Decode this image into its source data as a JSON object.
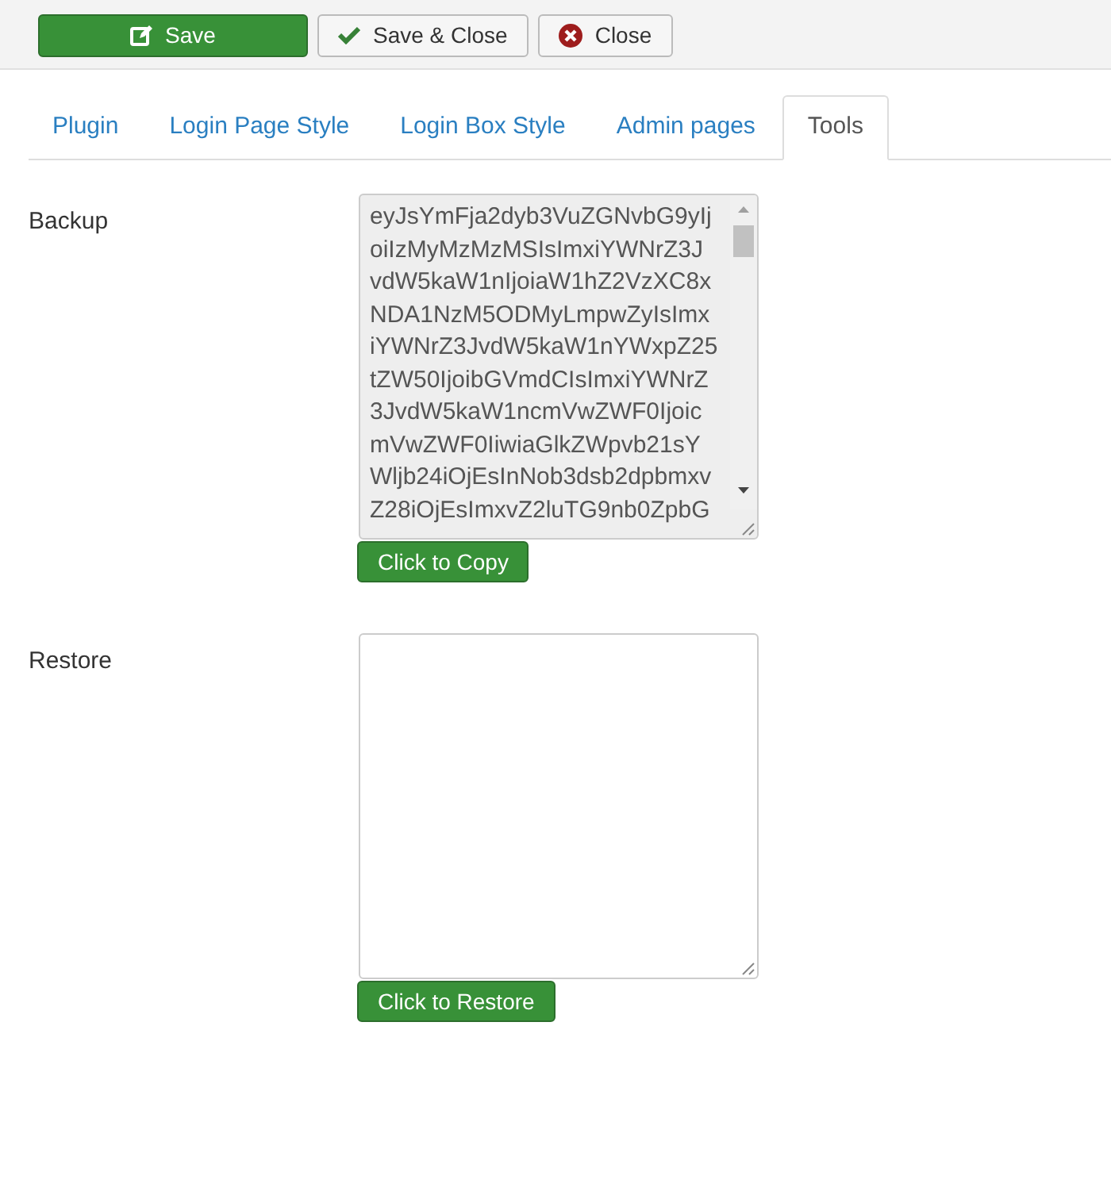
{
  "toolbar": [
    {
      "label": "Save",
      "kind": "save"
    },
    {
      "label": "Save & Close",
      "kind": "save_close"
    },
    {
      "label": "Close",
      "kind": "close"
    }
  ],
  "tabs": [
    {
      "label": "Plugin",
      "selected": false
    },
    {
      "label": "Login Page Style",
      "selected": false
    },
    {
      "label": "Login Box Style",
      "selected": false
    },
    {
      "label": "Admin pages",
      "selected": false
    },
    {
      "label": "Tools",
      "selected": true
    }
  ],
  "fields": [
    {
      "label": "Backup",
      "readonly": true,
      "lines": [
        "eyJsYmFja2dyb3VuZGNvbG9yIj",
        "oiIzMyMzMzMSIsImxiYWNrZ3J",
        "vdW5kaW1nIjoiaW1hZ2VzXC8x",
        "NDA1NzM5ODMyLmpwZyIsImx",
        "iYWNrZ3JvdW5kaW1nYWxpZ25",
        "tZW50IjoibGVmdCIsImxiYWNrZ",
        "3JvdW5kaW1ncmVwZWF0Ijoic",
        "mVwZWF0IiwiaGlkZWpvb21sY",
        "Wljb24iOjEsInNob3dsb2dpbmxv",
        "Z28iOjEsImxvZ2luTG9nb0ZpbG"
      ],
      "button": "Click to Copy"
    },
    {
      "label": "Restore",
      "readonly": false,
      "button": "Click to Restore"
    }
  ]
}
